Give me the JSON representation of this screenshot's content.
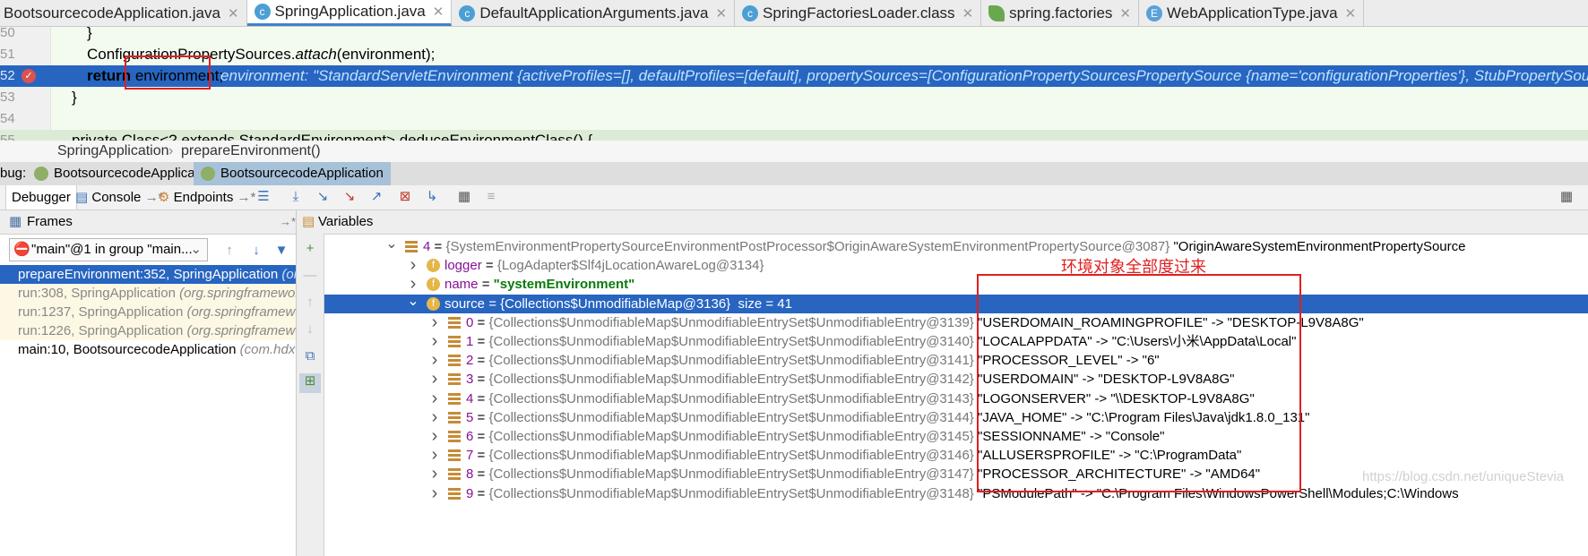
{
  "tabs": [
    {
      "label": "BootsourcecodeApplication.java",
      "icon": "class-icon",
      "active": false
    },
    {
      "label": "SpringApplication.java",
      "icon": "class-icon",
      "active": true
    },
    {
      "label": "DefaultApplicationArguments.java",
      "icon": "class-icon",
      "active": false
    },
    {
      "label": "SpringFactoriesLoader.class",
      "icon": "class-icon",
      "active": false
    },
    {
      "label": "spring.factories",
      "icon": "spring-file-icon",
      "active": false
    },
    {
      "label": "WebApplicationType.java",
      "icon": "enum-icon",
      "active": false
    }
  ],
  "editor": {
    "lines": [
      {
        "num": "50",
        "code": "}"
      },
      {
        "num": "51",
        "code_a": "ConfigurationPropertySources.",
        "code_b": "attach",
        "code_c": "(environment);"
      },
      {
        "num": "52",
        "kw": "return",
        "code": " environment;",
        "inline": "environment: \"StandardServletEnvironment {activeProfiles=[], defaultProfiles=[default], propertySources=[ConfigurationPropertySourcesPropertySource {name='configurationProperties'}, StubPropertySource {name='servletCon"
      },
      {
        "num": "53",
        "code": "}"
      },
      {
        "num": "54",
        "code": ""
      },
      {
        "num": "55",
        "code": "private Class<? extends StandardEnvironment> deduceEnvironmentClass() {"
      }
    ]
  },
  "breadcrumb": {
    "class": "SpringApplication",
    "sep": "›",
    "method": "prepareEnvironment()"
  },
  "debug_sessions": {
    "prefix": "bug:",
    "items": [
      "BootsourcecodeApplication",
      "BootsourcecodeApplication"
    ]
  },
  "toolbar": {
    "debugger": "Debugger",
    "console": "Console",
    "endpoints": "Endpoints"
  },
  "frames": {
    "title": "Frames",
    "thread": "\"main\"@1 in group \"main...",
    "items": [
      {
        "text": "prepareEnvironment:352, SpringApplication",
        "pkg": "(org.springframework",
        "state": "sel"
      },
      {
        "text": "run:308, SpringApplication",
        "pkg": "(org.springframework",
        "state": "lib"
      },
      {
        "text": "run:1237, SpringApplication",
        "pkg": "(org.springframework",
        "state": "lib"
      },
      {
        "text": "run:1226, SpringApplication",
        "pkg": "(org.springframework",
        "state": "lib"
      },
      {
        "text": "main:10, BootsourcecodeApplication",
        "pkg": "(com.hdx.bo",
        "state": "normal"
      }
    ]
  },
  "variables": {
    "title": "Variables",
    "rows": [
      {
        "indent": 0,
        "expanded": true,
        "icon": "list",
        "name": "4",
        "eq": " = ",
        "type": "{SystemEnvironmentPropertySourceEnvironmentPostProcessor$OriginAwareSystemEnvironmentPropertySource@3087}",
        "value": " \"OriginAwareSystemEnvironmentPropertySource"
      },
      {
        "indent": 1,
        "expanded": false,
        "icon": "field",
        "name": "logger",
        "eq": " = ",
        "type": "{LogAdapter$Slf4jLocationAwareLog@3134}",
        "value": ""
      },
      {
        "indent": 1,
        "expanded": false,
        "icon": "field",
        "name": "name",
        "eq": " = ",
        "type": "",
        "value": "\"systemEnvironment\""
      },
      {
        "indent": 1,
        "expanded": true,
        "icon": "field",
        "name": "source",
        "eq": " = ",
        "type": "{Collections$UnmodifiableMap@3136}",
        "value": "  size = 41",
        "sel": true
      },
      {
        "indent": 2,
        "expanded": false,
        "icon": "list",
        "name": "0",
        "eq": " = ",
        "type": "{Collections$UnmodifiableMap$UnmodifiableEntrySet$UnmodifiableEntry@3139}",
        "value": " \"USERDOMAIN_ROAMINGPROFILE\" -> \"DESKTOP-L9V8A8G\""
      },
      {
        "indent": 2,
        "expanded": false,
        "icon": "list",
        "name": "1",
        "eq": " = ",
        "type": "{Collections$UnmodifiableMap$UnmodifiableEntrySet$UnmodifiableEntry@3140}",
        "value": " \"LOCALAPPDATA\" -> \"C:\\Users\\小米\\AppData\\Local\""
      },
      {
        "indent": 2,
        "expanded": false,
        "icon": "list",
        "name": "2",
        "eq": " = ",
        "type": "{Collections$UnmodifiableMap$UnmodifiableEntrySet$UnmodifiableEntry@3141}",
        "value": " \"PROCESSOR_LEVEL\" -> \"6\""
      },
      {
        "indent": 2,
        "expanded": false,
        "icon": "list",
        "name": "3",
        "eq": " = ",
        "type": "{Collections$UnmodifiableMap$UnmodifiableEntrySet$UnmodifiableEntry@3142}",
        "value": " \"USERDOMAIN\" -> \"DESKTOP-L9V8A8G\""
      },
      {
        "indent": 2,
        "expanded": false,
        "icon": "list",
        "name": "4",
        "eq": " = ",
        "type": "{Collections$UnmodifiableMap$UnmodifiableEntrySet$UnmodifiableEntry@3143}",
        "value": " \"LOGONSERVER\" -> \"\\\\DESKTOP-L9V8A8G\""
      },
      {
        "indent": 2,
        "expanded": false,
        "icon": "list",
        "name": "5",
        "eq": " = ",
        "type": "{Collections$UnmodifiableMap$UnmodifiableEntrySet$UnmodifiableEntry@3144}",
        "value": " \"JAVA_HOME\" -> \"C:\\Program Files\\Java\\jdk1.8.0_131\""
      },
      {
        "indent": 2,
        "expanded": false,
        "icon": "list",
        "name": "6",
        "eq": " = ",
        "type": "{Collections$UnmodifiableMap$UnmodifiableEntrySet$UnmodifiableEntry@3145}",
        "value": " \"SESSIONNAME\" -> \"Console\""
      },
      {
        "indent": 2,
        "expanded": false,
        "icon": "list",
        "name": "7",
        "eq": " = ",
        "type": "{Collections$UnmodifiableMap$UnmodifiableEntrySet$UnmodifiableEntry@3146}",
        "value": " \"ALLUSERSPROFILE\" -> \"C:\\ProgramData\""
      },
      {
        "indent": 2,
        "expanded": false,
        "icon": "list",
        "name": "8",
        "eq": " = ",
        "type": "{Collections$UnmodifiableMap$UnmodifiableEntrySet$UnmodifiableEntry@3147}",
        "value": " \"PROCESSOR_ARCHITECTURE\" -> \"AMD64\""
      },
      {
        "indent": 2,
        "expanded": false,
        "icon": "list",
        "name": "9",
        "eq": " = ",
        "type": "{Collections$UnmodifiableMap$UnmodifiableEntrySet$UnmodifiableEntry@3148}",
        "value": " \"PSModulePath\" -> \"C:\\Program Files\\WindowsPowerShell\\Modules;C:\\Windows"
      }
    ]
  },
  "annotation": {
    "text": "环境对象全部度过来",
    "color": "#e02020"
  },
  "watermark": "https://blog.csdn.net/uniqueStevia",
  "colors": {
    "selection": "#2765c1",
    "editor_bg": "#f3fbef",
    "annotation": "#e02020"
  }
}
